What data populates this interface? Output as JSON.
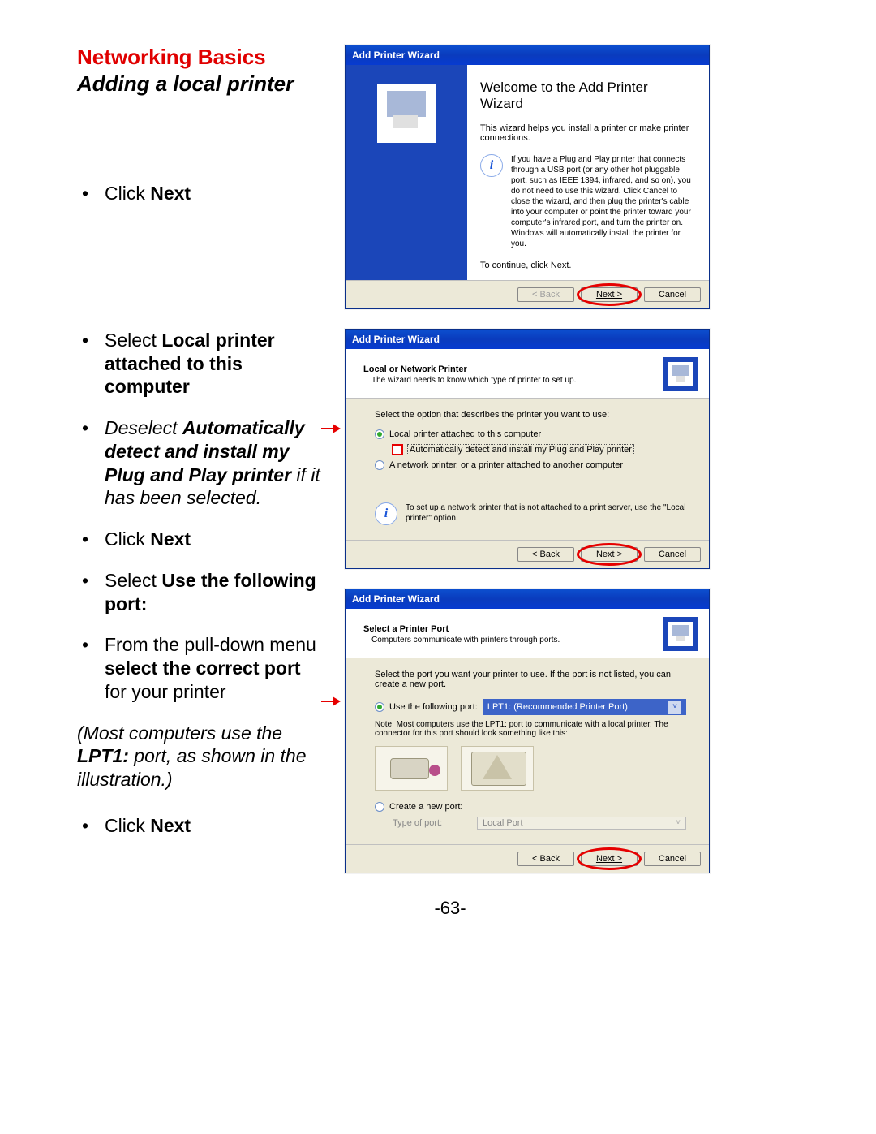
{
  "heading": {
    "section": "Networking Basics",
    "subtitle": "Adding a local printer"
  },
  "instructions": {
    "step1": {
      "pre": "Click ",
      "bold": "Next"
    },
    "step2": {
      "pre": "Select ",
      "bold": "Local printer attached to this computer"
    },
    "step3": {
      "pre": "Deselect ",
      "bold": "Automatically detect and install my Plug and Play printer",
      "post": " if it has been selected."
    },
    "step4": {
      "pre": "Click ",
      "bold": "Next"
    },
    "step5": {
      "pre": "Select ",
      "bold": "Use the following port:"
    },
    "step6": {
      "pre": "From the pull-down menu ",
      "bold": "select the correct port",
      "post": " for your printer"
    },
    "note": {
      "pre": "(Most computers use the ",
      "bold": "LPT1:",
      "post": " port, as shown in the illustration.)"
    },
    "step7": {
      "pre": "Click ",
      "bold": "Next"
    }
  },
  "wizard_common": {
    "title": "Add Printer Wizard",
    "back": "< Back",
    "next": "Next >",
    "cancel": "Cancel"
  },
  "wizard1": {
    "heading": "Welcome to the Add Printer Wizard",
    "desc": "This wizard helps you install a printer or make printer connections.",
    "info": "If you have a Plug and Play printer that connects through a USB port (or any other hot pluggable port, such as IEEE 1394, infrared, and so on), you do not need to use this wizard. Click Cancel to close the wizard, and then plug the printer's cable into your computer or point the printer toward your computer's infrared port, and turn the printer on. Windows will automatically install the printer for you.",
    "continue": "To continue, click Next."
  },
  "wizard2": {
    "htitle": "Local or Network Printer",
    "hsub": "The wizard needs to know which type of printer to set up.",
    "prompt": "Select the option that describes the printer you want to use:",
    "opt_local": "Local printer attached to this computer",
    "opt_auto": "Automatically detect and install my Plug and Play printer",
    "opt_network": "A network printer, or a printer attached to another computer",
    "tip": "To set up a network printer that is not attached to a print server, use the \"Local printer\" option."
  },
  "wizard3": {
    "htitle": "Select a Printer Port",
    "hsub": "Computers communicate with printers through ports.",
    "prompt": "Select the port you want your printer to use. If the port is not listed, you can create a new port.",
    "opt_use": "Use the following port:",
    "port_value": "LPT1: (Recommended Printer Port)",
    "note": "Note: Most computers use the LPT1: port to communicate with a local printer. The connector for this port should look something like this:",
    "opt_create": "Create a new port:",
    "type_label": "Type of port:",
    "type_value": "Local Port"
  },
  "page_number": "-63-"
}
